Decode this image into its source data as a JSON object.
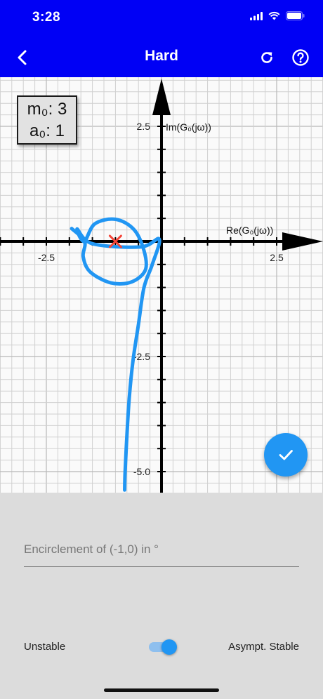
{
  "status_bar": {
    "time": "3:28"
  },
  "app_bar": {
    "title": "Hard",
    "back_icon": "chevron-left-icon",
    "refresh_icon": "refresh-icon",
    "help_icon": "help-circle-icon"
  },
  "params": {
    "m_label": "m₀: 3",
    "a_label": "a₀: 1"
  },
  "chart_data": {
    "type": "line",
    "title": "",
    "xlabel": "Re(G₀(jω))",
    "ylabel": "Im(G₀(jω))",
    "x_ticks": [
      {
        "value": -2.5,
        "label": "-2.5"
      },
      {
        "value": 2.5,
        "label": "2.5"
      }
    ],
    "y_ticks": [
      {
        "value": 2.5,
        "label": "2.5"
      },
      {
        "value": -2.5,
        "label": "-2.5"
      },
      {
        "value": -5.0,
        "label": "-5.0"
      }
    ],
    "critical_point": {
      "x": -1,
      "y": 0,
      "marker": "x",
      "color": "#f44336"
    },
    "grid": true,
    "series": [
      {
        "color": "#2196f3",
        "points": [
          [
            -1.95,
            0.28
          ],
          [
            -1.67,
            0.0
          ],
          [
            -1.7,
            -0.33
          ],
          [
            -1.55,
            -0.66
          ],
          [
            -1.1,
            -0.9
          ],
          [
            -0.65,
            -0.88
          ],
          [
            -0.35,
            -0.62
          ],
          [
            -0.38,
            -0.2
          ],
          [
            -0.6,
            0.26
          ],
          [
            -1.0,
            0.48
          ],
          [
            -1.45,
            0.38
          ],
          [
            -1.68,
            0.0
          ],
          [
            -1.83,
            0.27
          ],
          [
            -1.5,
            -0.05
          ],
          [
            -0.45,
            -0.12
          ],
          [
            -0.05,
            0.05
          ],
          [
            -0.2,
            -0.5
          ],
          [
            -0.38,
            -1.0
          ],
          [
            -0.5,
            -1.8
          ],
          [
            -0.62,
            -2.6
          ],
          [
            -0.7,
            -3.4
          ],
          [
            -0.75,
            -4.2
          ],
          [
            -0.79,
            -5.0
          ],
          [
            -0.8,
            -5.4
          ]
        ]
      }
    ]
  },
  "fab": {
    "icon": "check-icon"
  },
  "form": {
    "encirclement_placeholder": "Encirclement of (-1,0) in °",
    "encirclement_value": ""
  },
  "stability": {
    "left_label": "Unstable",
    "right_label": "Asympt. Stable",
    "switch_on": true
  }
}
